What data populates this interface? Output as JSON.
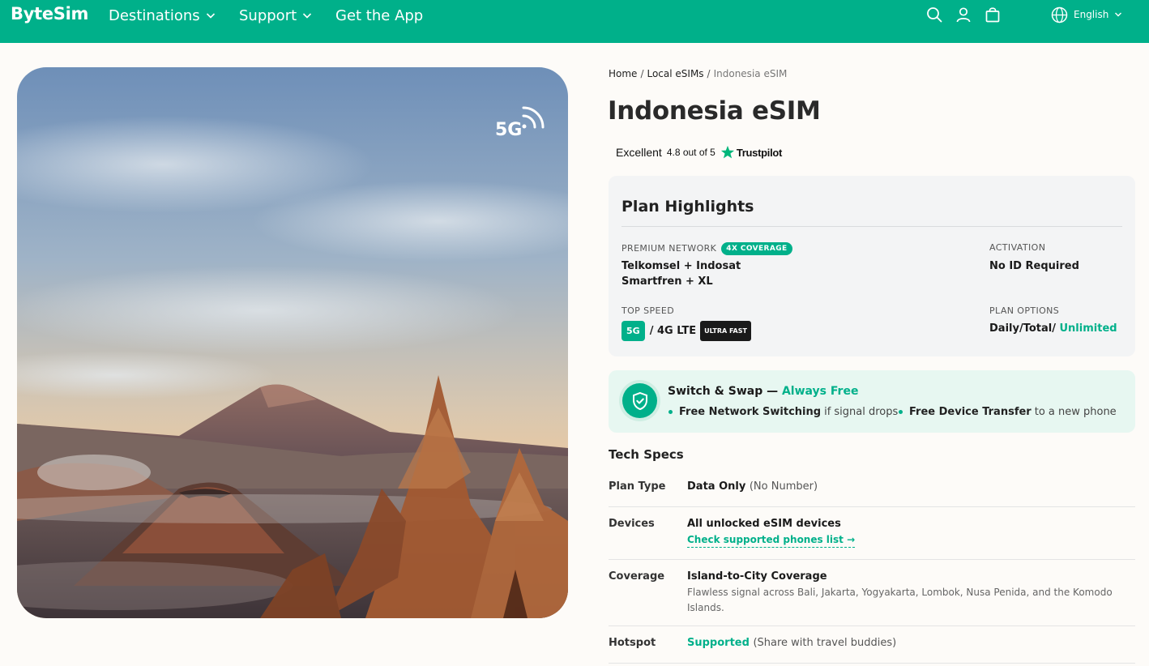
{
  "header": {
    "logo": "ByteSim",
    "nav": [
      {
        "label": "Destinations",
        "has_dropdown": true
      },
      {
        "label": "Support",
        "has_dropdown": true
      },
      {
        "label": "Get the App",
        "has_dropdown": false
      }
    ],
    "icons": [
      "search-icon",
      "user-icon",
      "bag-icon"
    ],
    "language": "English"
  },
  "hero": {
    "badge": "5G",
    "image_alt": "Mount Bromo volcano at sunrise"
  },
  "breadcrumb": {
    "items": [
      "Home",
      "Local eSIMs"
    ],
    "current": "Indonesia eSIM"
  },
  "product": {
    "title": "Indonesia eSIM"
  },
  "trustpilot": {
    "rating_label": "Excellent",
    "score": "4.8 out of 5",
    "brand": "Trustpilot"
  },
  "highlights": {
    "title": "Plan Highlights",
    "network_label": "PREMIUM NETWORK",
    "network_badge": "4X COVERAGE",
    "network_line1": "Telkomsel + Indosat",
    "network_line2": "Smartfren + XL",
    "activation_label": "ACTIVATION",
    "activation_value": "No ID Required",
    "speed_label": "TOP SPEED",
    "speed_tag": "5G",
    "speed_value": "/ 4G LTE",
    "speed_badge": "ULTRA FAST",
    "options_label": "PLAN OPTIONS",
    "options_value": "Daily/Total/",
    "options_highlight": "Unlimited"
  },
  "swap": {
    "title": "Switch & Swap —",
    "title_highlight": "Always Free",
    "item1_bold": "Free Network Switching",
    "item1_rest": "if signal drops",
    "item2_bold": "Free Device Transfer",
    "item2_rest": "to a new phone"
  },
  "tech_specs": {
    "title": "Tech Specs",
    "plan_type_key": "Plan Type",
    "plan_type_value": "Data Only",
    "plan_type_note": "(No Number)",
    "devices_key": "Devices",
    "devices_value": "All unlocked eSIM devices",
    "devices_link": "Check supported phones list →",
    "coverage_key": "Coverage",
    "coverage_value": "Island-to-City Coverage",
    "coverage_desc": "Flawless signal across Bali, Jakarta, Yogyakarta, Lombok, Nusa Penida, and the Komodo Islands.",
    "hotspot_key": "Hotspot",
    "hotspot_value": "Supported",
    "hotspot_note": "(Share with travel buddies)"
  },
  "colors": {
    "brand": "#00b08a",
    "background": "#fdfbf8",
    "card": "#f3f4f5",
    "swap_bg": "#e7f7f1"
  }
}
